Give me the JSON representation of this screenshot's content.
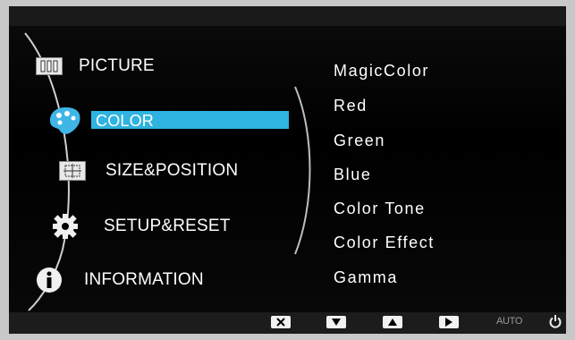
{
  "menu": {
    "items": [
      {
        "label": "PICTURE",
        "icon": "picture-icon"
      },
      {
        "label": "COLOR",
        "icon": "color-palette-icon",
        "selected": true
      },
      {
        "label": "SIZE&POSITION",
        "icon": "size-position-icon"
      },
      {
        "label": "SETUP&RESET",
        "icon": "gear-icon"
      },
      {
        "label": "INFORMATION",
        "icon": "info-icon"
      }
    ]
  },
  "submenu": {
    "items": [
      "MagicColor",
      "Red",
      "Green",
      "Blue",
      "Color Tone",
      "Color Effect",
      "Gamma"
    ]
  },
  "bottom_bar": {
    "buttons": [
      "close-icon",
      "down-arrow-icon",
      "up-arrow-icon",
      "enter-arrow-icon"
    ],
    "auto_label": "AUTO",
    "power_icon": "power-icon"
  },
  "colors": {
    "highlight": "#2fb3e0",
    "background": "#000000",
    "text": "#ffffff"
  }
}
